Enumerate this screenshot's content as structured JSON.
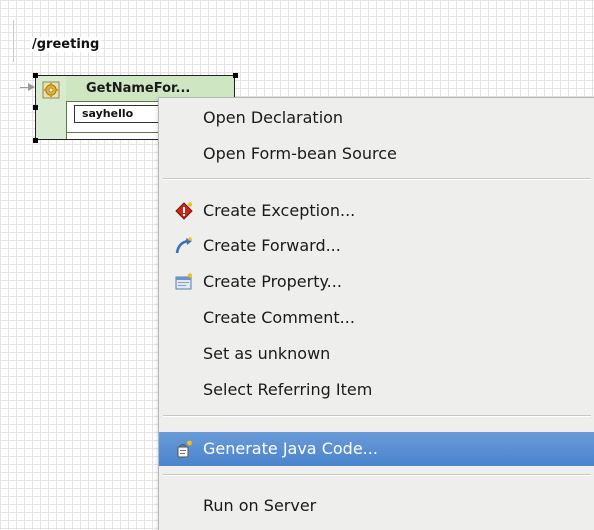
{
  "canvas": {
    "route_label": "/greeting"
  },
  "node": {
    "title": "GetNameFor...",
    "forward_name": "sayhello"
  },
  "context_menu": {
    "open_declaration": "Open Declaration",
    "open_formbean_source": "Open Form-bean Source",
    "create_exception": "Create Exception...",
    "create_forward": "Create Forward...",
    "create_property": "Create Property...",
    "create_comment": "Create Comment...",
    "set_as_unknown": "Set as unknown",
    "select_referring_item": "Select Referring Item",
    "generate_java_code": "Generate Java Code...",
    "run_on_server": "Run on Server"
  },
  "colors": {
    "menu_background": "#eeeeec",
    "selection": "#4a84cc",
    "node_fill": "#cfe6c2"
  },
  "icons": {
    "node_icon": "gear-icon",
    "create_exception_icon": "exception-icon",
    "create_forward_icon": "forward-icon",
    "create_property_icon": "property-icon",
    "generate_java_code_icon": "wand-icon"
  }
}
